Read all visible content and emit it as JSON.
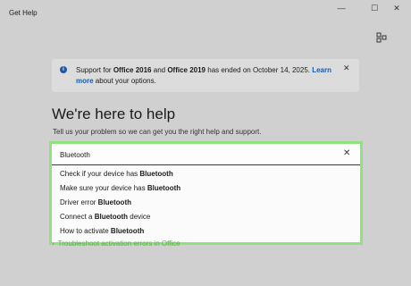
{
  "window": {
    "title": "Get Help",
    "minimize_glyph": "—",
    "maximize_glyph": "☐",
    "close_glyph": "✕"
  },
  "icons": {
    "share": "share-icon",
    "info": "info-icon",
    "close": "close-icon",
    "clear": "clear-icon"
  },
  "banner": {
    "info_glyph": "i",
    "text_prefix": "Support for ",
    "office_2016": "Office 2016",
    "text_and": " and ",
    "office_2019": "Office 2019",
    "text_suffix": " has ended on October 14, 2025. ",
    "learn_more": "Learn more",
    "text_end": " about your options.",
    "close_glyph": "✕",
    "accent_color": "#1e57a8"
  },
  "main": {
    "heading": "We're here to help",
    "subtext": "Tell us your problem so we can get you the right help and support."
  },
  "search": {
    "value": "Bluetooth",
    "clear_glyph": "✕",
    "highlight_color": "#8fe27e"
  },
  "suggestions": [
    {
      "before": "Check if your device has ",
      "bold": "Bluetooth",
      "after": ""
    },
    {
      "before": "Make sure your device has ",
      "bold": "Bluetooth",
      "after": ""
    },
    {
      "before": "Driver error ",
      "bold": "Bluetooth",
      "after": ""
    },
    {
      "before": "Connect a ",
      "bold": "Bluetooth",
      "after": " device"
    },
    {
      "before": "How to activate ",
      "bold": "Bluetooth",
      "after": ""
    }
  ],
  "background_item": {
    "chevron": "›",
    "label": "Troubleshoot activation errors in Office"
  }
}
